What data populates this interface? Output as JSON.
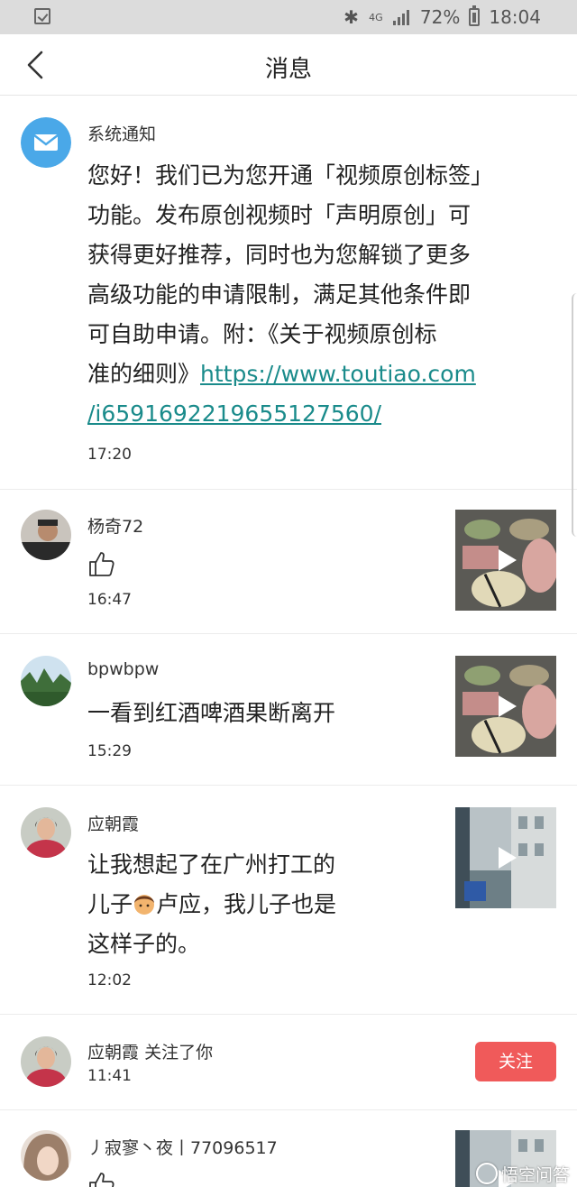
{
  "status_bar": {
    "battery": "72%",
    "time": "18:04",
    "network": "4G",
    "icons": [
      "checkbox-notification-icon",
      "bluetooth-icon",
      "4g-icon",
      "signal-icon",
      "battery-icon"
    ]
  },
  "header": {
    "title": "消息",
    "back_icon": "chevron-left-icon"
  },
  "messages": [
    {
      "sender": "系统通知",
      "avatar_icon": "mail-icon",
      "avatar_color": "#4aa8e8",
      "content_lines": [
        "您好！我们已为您开通「视频原创标签」",
        "功能。发布原创视频时「声明原创」可",
        "获得更好推荐，同时也为您解锁了更多",
        "高级功能的申请限制，满足其他条件即",
        "可自助申请。附：《关于视频原创标"
      ],
      "content_tail": "准的细则》",
      "link_line1": "https://www.toutiao.com",
      "link_line2": "/i6591692219655127560/",
      "time": "17:20"
    },
    {
      "sender": "杨奇72",
      "action_icon": "thumbs-up-icon",
      "time": "16:47",
      "thumb": "food-video-thumbnail"
    },
    {
      "sender": "bpwbpw",
      "content": "一看到红酒啤酒果断离开",
      "time": "15:29",
      "thumb": "food-video-thumbnail"
    },
    {
      "sender": "应朝霞",
      "content_line1": "让我想起了在广州打工的",
      "content_line2_a": "儿子",
      "content_line2_b": "卢应，我儿子也是",
      "content_line3": "这样子的。",
      "emoji": "boy-emoji",
      "time": "12:02",
      "thumb": "building-video-thumbnail"
    },
    {
      "sender": "应朝霞",
      "action": "关注了你",
      "time": "11:41",
      "button": "关注",
      "button_color": "#f05a5a"
    },
    {
      "sender": "丿寂寥丶夜丨77096517",
      "action_icon": "thumbs-up-icon",
      "thumb": "building-video-thumbnail"
    }
  ],
  "watermark": "悟空问答",
  "colors": {
    "link": "#1a8b8b",
    "status_bar_bg": "#dcdcdc",
    "follow_button": "#f05a5a"
  }
}
